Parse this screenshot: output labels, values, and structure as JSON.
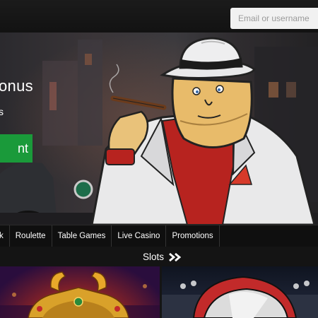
{
  "login": {
    "email_placeholder": "Email or username"
  },
  "hero": {
    "title": "onus",
    "subtitle": "s",
    "cta_label": "nt"
  },
  "nav": {
    "items": [
      "k",
      "Roulette",
      "Table Games",
      "Live Casino",
      "Promotions"
    ]
  },
  "section": {
    "title": "Slots",
    "arrow_icon": "double-chevron-right-icon"
  },
  "tiles": [
    {
      "icon": "golden-helmet-game-icon"
    },
    {
      "icon": "stadium-helmet-game-icon"
    }
  ],
  "colors": {
    "background": "#151515",
    "cta_green": "#1a9a3a",
    "nav_bg": "#0f0f0f",
    "text": "#ffffff"
  }
}
